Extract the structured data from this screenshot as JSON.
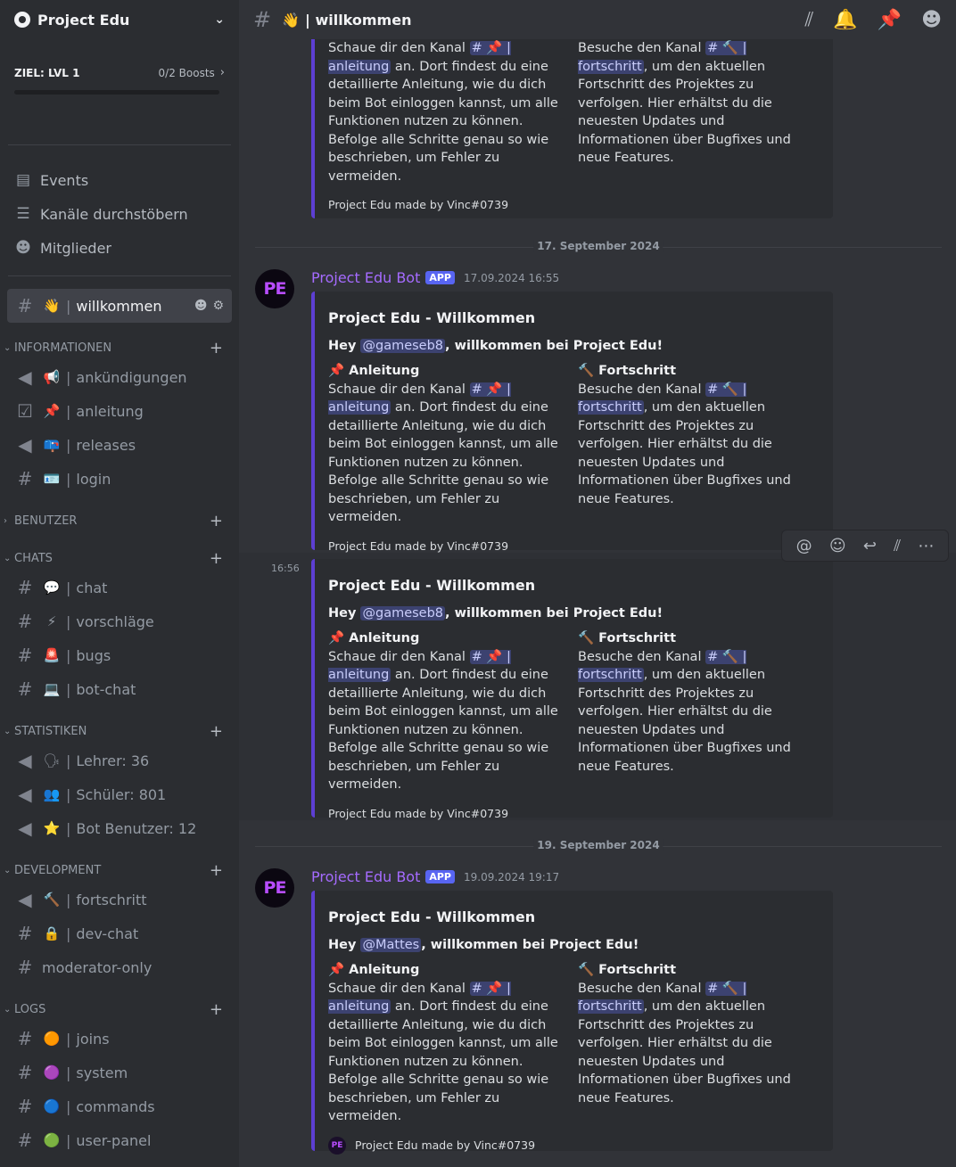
{
  "server": {
    "name": "Project Edu"
  },
  "boost": {
    "goal": "ZIEL: LVL 1",
    "count": "0/2 Boosts"
  },
  "nav": [
    {
      "label": "Events",
      "icon": "calendar-icon",
      "glyph": "▤"
    },
    {
      "label": "Kanäle durchstöbern",
      "icon": "browse-channels-icon",
      "glyph": "☰"
    },
    {
      "label": "Mitglieder",
      "icon": "members-icon",
      "glyph": "☻"
    }
  ],
  "active_channel": {
    "emoji": "👋",
    "name": "willkommen"
  },
  "categories": {
    "informationen": {
      "label": "INFORMATIONEN",
      "channels": [
        {
          "emoji": "📢",
          "name": "ankündigungen",
          "glyph": "◀",
          "icon": "announcement-icon"
        },
        {
          "emoji": "📌",
          "name": "anleitung",
          "glyph": "☑",
          "icon": "rules-icon"
        },
        {
          "emoji": "📪",
          "name": "releases",
          "glyph": "◀",
          "icon": "announcement-icon"
        },
        {
          "emoji": "🪪",
          "name": "login",
          "glyph": "#",
          "icon": "text-channel-icon"
        }
      ]
    },
    "benutzer": {
      "label": "BENUTZER"
    },
    "chats": {
      "label": "CHATS",
      "channels": [
        {
          "emoji": "💬",
          "name": "chat",
          "glyph": "#",
          "icon": "text-channel-icon"
        },
        {
          "emoji": "⚡",
          "name": "vorschläge",
          "glyph": "#",
          "icon": "text-channel-icon"
        },
        {
          "emoji": "🚨",
          "name": "bugs",
          "glyph": "#",
          "icon": "text-channel-icon"
        },
        {
          "emoji": "💻",
          "name": "bot-chat",
          "glyph": "#",
          "icon": "text-channel-icon"
        }
      ]
    },
    "statistiken": {
      "label": "STATISTIKEN",
      "channels": [
        {
          "emoji": "🗣",
          "name": "Lehrer: 36",
          "glyph": "◀",
          "icon": "announcement-icon"
        },
        {
          "emoji": "👥",
          "name": "Schüler: 801",
          "glyph": "◀",
          "icon": "announcement-icon"
        },
        {
          "emoji": "⭐",
          "name": "Bot Benutzer: 12",
          "glyph": "◀",
          "icon": "announcement-icon"
        }
      ]
    },
    "development": {
      "label": "DEVELOPMENT",
      "channels": [
        {
          "emoji": "🔨",
          "name": "fortschritt",
          "glyph": "◀",
          "icon": "announcement-icon"
        },
        {
          "emoji": "🔒",
          "name": "dev-chat",
          "glyph": "#",
          "icon": "text-channel-icon"
        },
        {
          "emoji": "",
          "name": "moderator-only",
          "glyph": "#",
          "icon": "text-channel-icon"
        }
      ]
    },
    "logs": {
      "label": "LOGS",
      "channels": [
        {
          "emoji": "🟠",
          "name": "joins",
          "glyph": "#",
          "icon": "text-channel-icon"
        },
        {
          "emoji": "🟣",
          "name": "system",
          "glyph": "#",
          "icon": "text-channel-icon"
        },
        {
          "emoji": "🔵",
          "name": "commands",
          "glyph": "#",
          "icon": "text-channel-icon"
        },
        {
          "emoji": "🟢",
          "name": "user-panel",
          "glyph": "#",
          "icon": "text-channel-icon"
        }
      ]
    }
  },
  "topbar": {
    "emoji": "👋",
    "channel": "| willkommen"
  },
  "embed_common": {
    "title": "Project Edu - Willkommen",
    "greeting_prefix": "Hey ",
    "greeting_suffix": ", willkommen bei Project Edu!",
    "field1_name": "📌 Anleitung",
    "field1_value_a": "Schaue dir den Kanal ",
    "field1_channel": "# 📌 | anleitung",
    "field1_value_b": " an. Dort findest du eine detaillierte Anleitung, wie du dich beim Bot einloggen kannst, um alle Funktionen nutzen zu können. Befolge alle Schritte genau so wie beschrieben, um Fehler zu vermeiden.",
    "field2_name": "🔨 Fortschritt",
    "field2_value_a": "Besuche den Kanal ",
    "field2_channel": "# 🔨 | fortschritt",
    "field2_value_b": ", um den aktuellen Fortschritt des Projektes zu verfolgen. Hier erhältst du die neuesten Updates und Informationen über Bugfixes und neue Features.",
    "footer": "Project Edu made by Vinc#0739"
  },
  "date_separators": [
    "17. September 2024",
    "19. September 2024"
  ],
  "messages": [
    {
      "author": "Project Edu Bot",
      "tag": "APP",
      "time": "17.09.2024 16:55",
      "mention": "@gameseb8"
    },
    {
      "side_time": "16:56",
      "mention": "@gameseb8"
    },
    {
      "author": "Project Edu Bot",
      "tag": "APP",
      "time": "19.09.2024 19:17",
      "mention": "@Mattes"
    }
  ],
  "avatar_text": "PE",
  "colors": {
    "accent": "#5d3fd3",
    "author": "#a56bff",
    "app_tag": "#5865f2"
  }
}
